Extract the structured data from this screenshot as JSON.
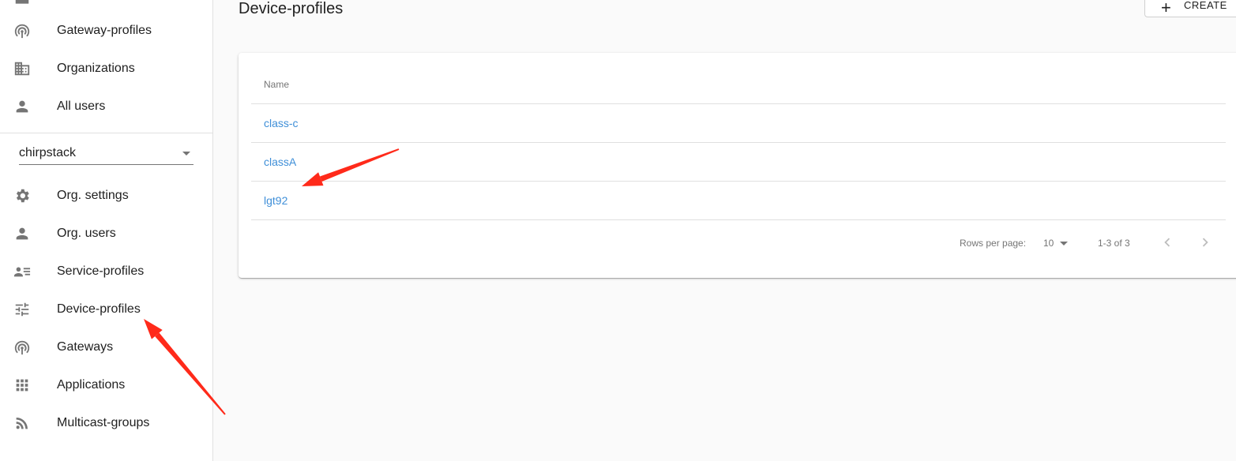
{
  "sidebar": {
    "top_items": [
      {
        "label": "Gateway-profiles",
        "icon": "gateway-profiles-icon"
      },
      {
        "label": "Organizations",
        "icon": "organizations-icon"
      },
      {
        "label": "All users",
        "icon": "user-icon"
      }
    ],
    "organization": {
      "selected": "chirpstack"
    },
    "org_items": [
      {
        "label": "Org. settings",
        "icon": "gear-icon"
      },
      {
        "label": "Org. users",
        "icon": "user-icon"
      },
      {
        "label": "Service-profiles",
        "icon": "service-profiles-icon"
      },
      {
        "label": "Device-profiles",
        "icon": "tune-icon"
      },
      {
        "label": "Gateways",
        "icon": "gateway-icon"
      },
      {
        "label": "Applications",
        "icon": "apps-grid-icon"
      },
      {
        "label": "Multicast-groups",
        "icon": "rss-feed-icon"
      }
    ]
  },
  "header": {
    "title": "Device-profiles",
    "create_label": "CREATE"
  },
  "table": {
    "column_name": "Name",
    "rows": [
      "class-c",
      "classA",
      "lgt92"
    ],
    "link_color": "#3f8fd8"
  },
  "pagination": {
    "rows_per_page_label": "Rows per page:",
    "rows_per_page": "10",
    "range": "1-3 of 3"
  },
  "annotations": {
    "arrow_color": "#ff2a1a"
  }
}
